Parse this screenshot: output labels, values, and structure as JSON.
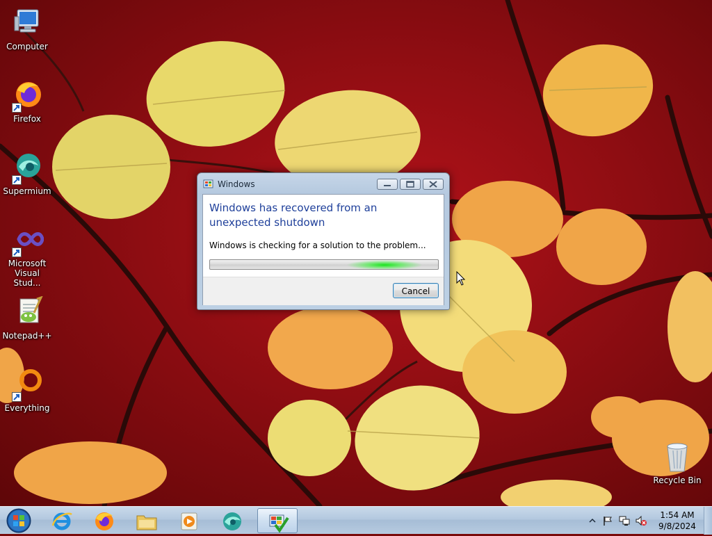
{
  "desktop": {
    "icons": [
      {
        "label": "Computer",
        "icon": "computer-icon"
      },
      {
        "label": "Firefox",
        "icon": "firefox-icon"
      },
      {
        "label": "Supermium",
        "icon": "supermium-icon"
      },
      {
        "label_line1": "Microsoft",
        "label_line2": "Visual Stud...",
        "icon": "visual-studio-icon"
      },
      {
        "label": "Notepad++",
        "icon": "notepad-plus-plus-icon"
      },
      {
        "label": "Everything",
        "icon": "everything-icon"
      },
      {
        "label": "Recycle Bin",
        "icon": "recycle-bin-icon"
      }
    ]
  },
  "dialog": {
    "title": "Windows",
    "heading": "Windows has recovered from an unexpected shutdown",
    "message": "Windows is checking for a solution to the problem...",
    "cancel_label": "Cancel",
    "progress_mode": "marquee",
    "progress_color": "#19e31e"
  },
  "taskbar": {
    "items": [
      "start-orb-icon",
      "internet-explorer-icon",
      "firefox-icon",
      "file-explorer-icon",
      "media-player-icon",
      "supermium-icon",
      "problem-reporting-icon"
    ],
    "tray_icons": [
      "show-hidden-icons-icon",
      "action-center-flag-icon",
      "network-icon",
      "volume-muted-icon"
    ],
    "time": "1:54 AM",
    "date": "9/8/2024"
  },
  "colors": {
    "heading": "#1e3f9a",
    "taskbar": "#b3c8df",
    "wallpaper": "#8e0d12"
  }
}
